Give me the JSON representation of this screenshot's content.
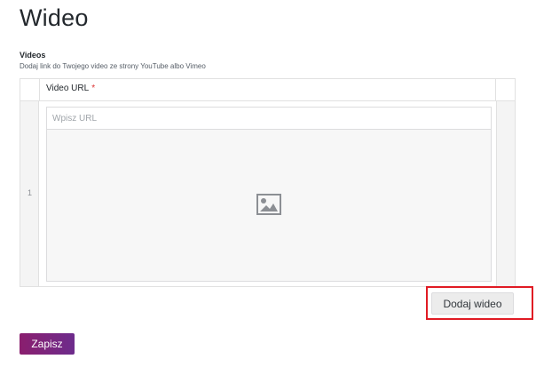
{
  "page": {
    "title": "Wideo"
  },
  "field": {
    "label": "Videos",
    "description": "Dodaj link do Twojego video ze strony YouTube albo Vimeo"
  },
  "repeater": {
    "column_title": "Video URL",
    "required_marker": "*",
    "rows": [
      {
        "number": "1",
        "url_value": "",
        "url_placeholder": "Wpisz URL",
        "preview_icon": "image-placeholder-icon"
      }
    ]
  },
  "actions": {
    "add_label": "Dodaj wideo",
    "save_label": "Zapisz"
  },
  "colors": {
    "save_button_gradient_start": "#8a1e6e",
    "save_button_gradient_end": "#6d2c8c",
    "highlight_border": "#e01b24",
    "required_marker": "#dc3232"
  }
}
